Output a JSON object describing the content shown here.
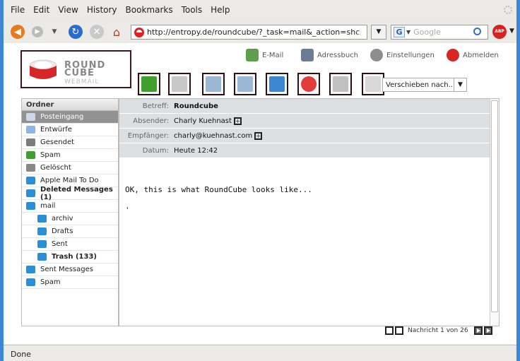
{
  "browser": {
    "menu": [
      {
        "label": "File"
      },
      {
        "label": "Edit"
      },
      {
        "label": "View"
      },
      {
        "label": "History"
      },
      {
        "label": "Bookmarks"
      },
      {
        "label": "Tools"
      },
      {
        "label": "Help"
      }
    ],
    "url": "http://entropy.de/roundcube/?_task=mail&_action=shc",
    "search_placeholder": "Google",
    "search_engine_letter": "G",
    "addon_badge": "ABP",
    "status_text": "Done"
  },
  "app": {
    "logo_line1": "ROUND",
    "logo_line2": "CUBE",
    "logo_line3": "WEBMAIL",
    "topnav": [
      {
        "label": "E-Mail",
        "icon": "email-icon"
      },
      {
        "label": "Adressbuch",
        "icon": "addressbook-icon"
      },
      {
        "label": "Einstellungen",
        "icon": "settings-icon"
      },
      {
        "label": "Abmelden",
        "icon": "logout-icon"
      }
    ],
    "toolbar": [
      {
        "name": "back-button",
        "icon": "arrow-left-icon",
        "color": "#3fa030"
      },
      {
        "name": "compose-button",
        "icon": "compose-icon",
        "color": "#c8c8c8"
      },
      {
        "name": "reply-button",
        "icon": "reply-icon",
        "color": "#9ab7d3"
      },
      {
        "name": "reply-all-button",
        "icon": "reply-all-icon",
        "color": "#9ab7d3"
      },
      {
        "name": "forward-button",
        "icon": "forward-icon",
        "color": "#3a86d1"
      },
      {
        "name": "delete-button",
        "icon": "delete-icon",
        "color": "#e23b3b"
      },
      {
        "name": "print-button",
        "icon": "print-icon",
        "color": "#c0c0c0"
      },
      {
        "name": "source-button",
        "icon": "source-icon",
        "color": "#d8d8d8"
      }
    ],
    "move_select": "Verschieben nach...",
    "folders_header": "Ordner",
    "folders": [
      {
        "label": "Posteingang",
        "selected": true,
        "bold": false,
        "sub": false,
        "color": "#cfd8e6"
      },
      {
        "label": "Entwürfe",
        "selected": false,
        "bold": false,
        "sub": false,
        "color": "#8fb6e3"
      },
      {
        "label": "Gesendet",
        "selected": false,
        "bold": false,
        "sub": false,
        "color": "#7c7c7c"
      },
      {
        "label": "Spam",
        "selected": false,
        "bold": false,
        "sub": false,
        "color": "#3fa030"
      },
      {
        "label": "Gelöscht",
        "selected": false,
        "bold": false,
        "sub": false,
        "color": "#888888"
      },
      {
        "label": "Apple Mail To Do",
        "selected": false,
        "bold": false,
        "sub": false,
        "color": "#2b8fd7"
      },
      {
        "label": "Deleted Messages (1)",
        "selected": false,
        "bold": true,
        "sub": false,
        "color": "#2b8fd7"
      },
      {
        "label": "mail",
        "selected": false,
        "bold": false,
        "sub": false,
        "color": "#2b8fd7"
      },
      {
        "label": "archiv",
        "selected": false,
        "bold": false,
        "sub": true,
        "color": "#2b8fd7"
      },
      {
        "label": "Drafts",
        "selected": false,
        "bold": false,
        "sub": true,
        "color": "#2b8fd7"
      },
      {
        "label": "Sent",
        "selected": false,
        "bold": false,
        "sub": true,
        "color": "#2b8fd7"
      },
      {
        "label": "Trash (133)",
        "selected": false,
        "bold": true,
        "sub": true,
        "color": "#2b8fd7"
      },
      {
        "label": "Sent Messages",
        "selected": false,
        "bold": false,
        "sub": false,
        "color": "#2b8fd7"
      },
      {
        "label": "Spam",
        "selected": false,
        "bold": false,
        "sub": false,
        "color": "#2b8fd7"
      }
    ],
    "headers": {
      "subject_key": "Betreff:",
      "subject_val": "Roundcube",
      "from_key": "Absender:",
      "from_val": "Charly Kuehnast",
      "to_key": "Empfänger:",
      "to_val": "charly@kuehnast.com",
      "date_key": "Datum:",
      "date_val": "Heute 12:42"
    },
    "body_line1": "OK, this is what RoundCube looks like...",
    "body_line2": "'",
    "pager_text": "Nachricht 1 von 26"
  }
}
